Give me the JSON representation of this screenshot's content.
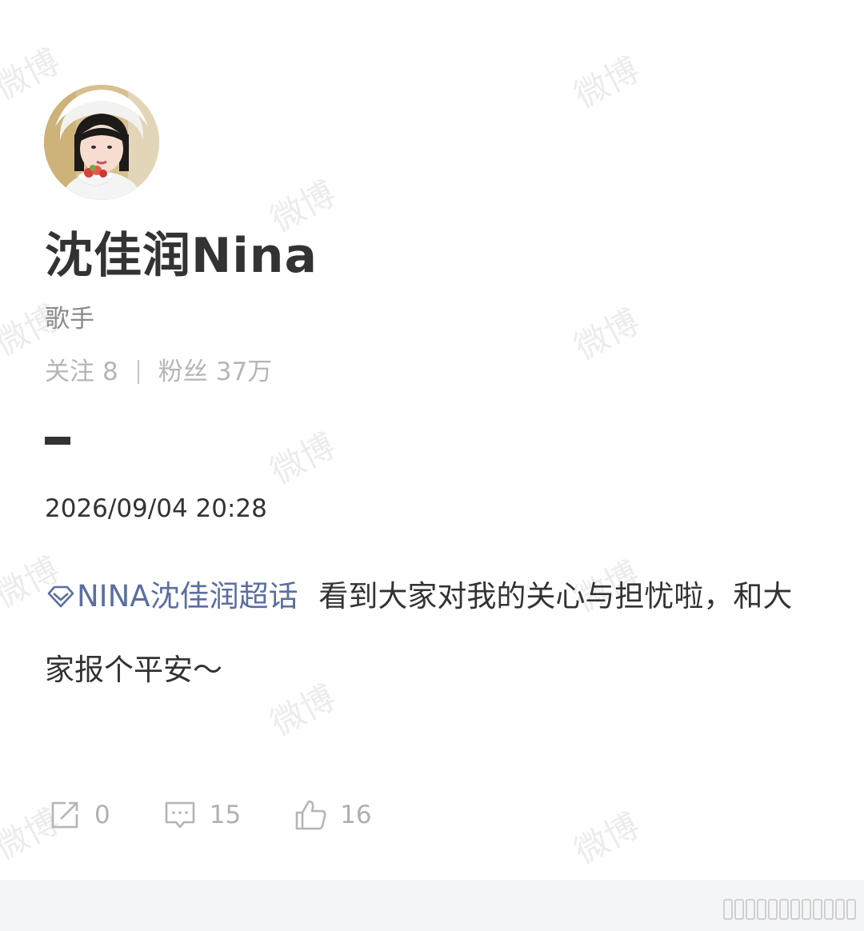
{
  "watermark_text": "微博",
  "profile": {
    "name": "沈佳润Nina",
    "role": "歌手",
    "following_label": "关注",
    "following_count": "8",
    "followers_label": "粉丝",
    "followers_count": "37万"
  },
  "post": {
    "timestamp": "2026/09/04 20:28",
    "topic": "NINA沈佳润超话",
    "text": "看到大家对我的关心与担忧啦，和大家报个平安～"
  },
  "actions": {
    "repost_count": "0",
    "comment_count": "15",
    "like_count": "16"
  },
  "colors": {
    "topic": "#5a6ea1",
    "muted": "#b0b0b0",
    "text": "#333333",
    "footer_bg": "#f4f5f7"
  },
  "icons": [
    "diamond-icon",
    "repost-icon",
    "comment-icon",
    "like-icon"
  ]
}
